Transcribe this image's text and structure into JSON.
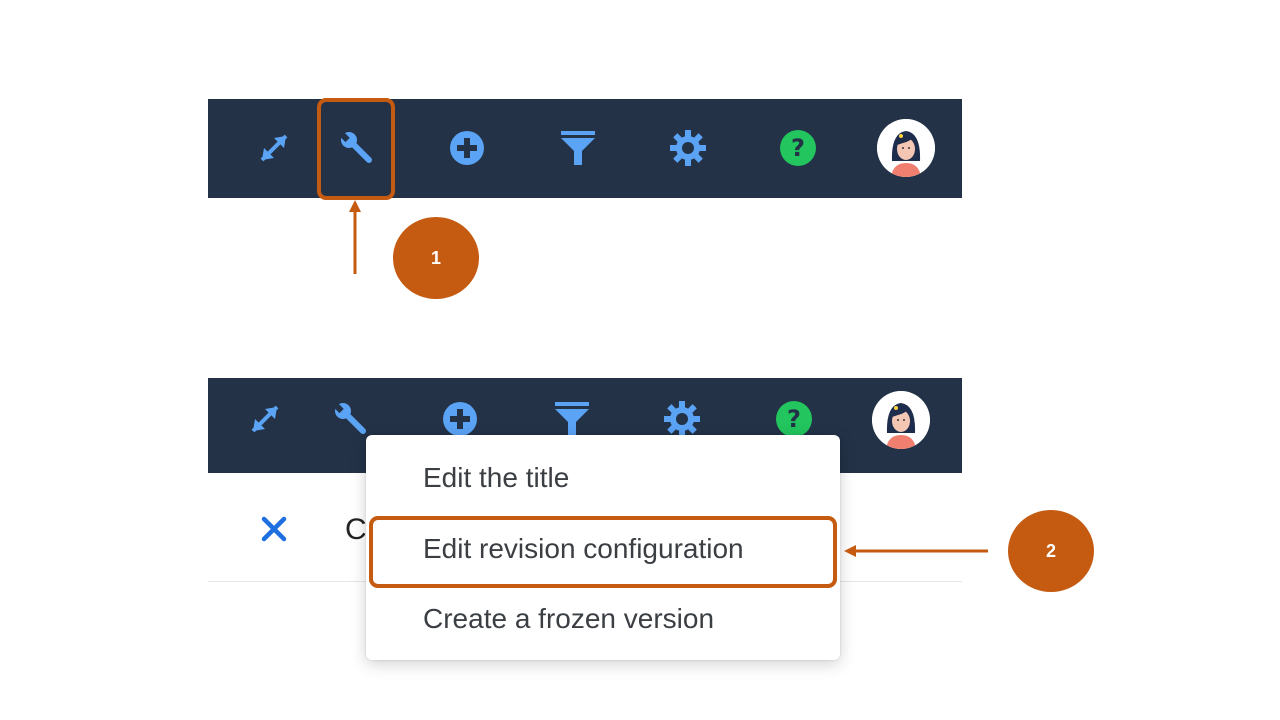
{
  "toolbar": {
    "icons": [
      "expand-icon",
      "wrench-icon",
      "add-icon",
      "filter-icon",
      "gear-icon",
      "help-icon",
      "avatar"
    ],
    "colors": {
      "background": "#233247",
      "icon_blue": "#5ba3f5",
      "help_green": "#22c55e"
    }
  },
  "panel": {
    "close_icon": "close-icon",
    "title_partial": "C"
  },
  "menu": {
    "items": [
      {
        "label": "Edit the title"
      },
      {
        "label": "Edit revision configuration"
      },
      {
        "label": "Create a frozen version"
      }
    ]
  },
  "annotations": {
    "step1": "1",
    "step2": "2",
    "color": "#c55a11"
  }
}
